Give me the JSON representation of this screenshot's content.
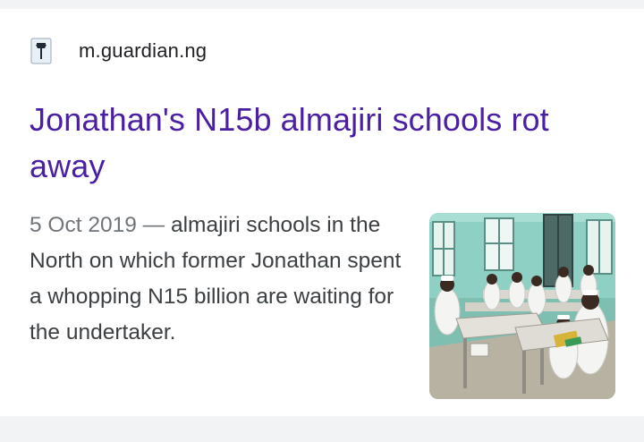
{
  "result": {
    "source": "m.guardian.ng",
    "favicon_icon": "guardian-favicon-icon",
    "title": "Jonathan's N15b almajiri schools rot away",
    "date": "5 Oct 2019",
    "separator": " — ",
    "snippet": "almajiri schools in the North on which former Jonathan spent a whopping N15 billion are waiting for the undertaker.",
    "thumbnail_icon": "classroom-photo-thumbnail",
    "colors": {
      "title": "#4a1fa3",
      "date": "#70757a",
      "snippet": "#3c4043",
      "source": "#202124",
      "background": "#f1f3f4"
    }
  }
}
